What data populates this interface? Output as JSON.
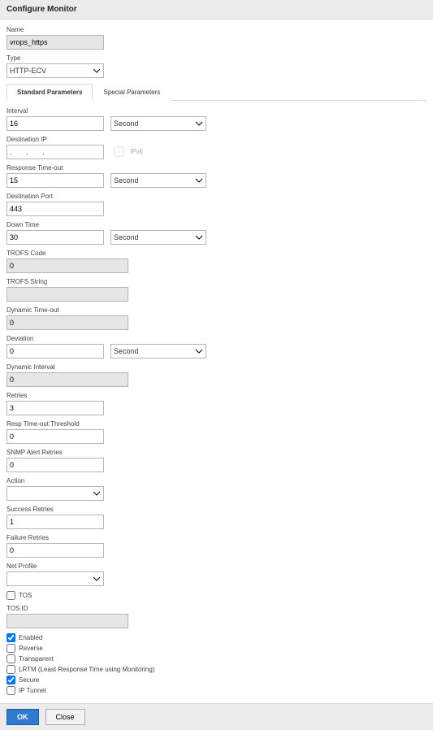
{
  "window": {
    "title": "Configure Monitor"
  },
  "form": {
    "name": {
      "label": "Name",
      "value": "vrops_https"
    },
    "type": {
      "label": "Type",
      "value": "HTTP-ECV"
    }
  },
  "tabs": {
    "standard": "Standard Parameters",
    "special": "Special Parameters"
  },
  "std": {
    "interval": {
      "label": "Interval",
      "value": "16",
      "unit": "Second"
    },
    "destip": {
      "label": "Destination IP",
      "value": ".       .       .",
      "ipv6": "IPv6"
    },
    "resp_to": {
      "label": "Response Time-out",
      "value": "15",
      "unit": "Second"
    },
    "destport": {
      "label": "Destination Port",
      "value": "443"
    },
    "downtime": {
      "label": "Down Time",
      "value": "30",
      "unit": "Second"
    },
    "trofs_code": {
      "label": "TROFS Code",
      "value": "0"
    },
    "trofs_string": {
      "label": "TROFS String",
      "value": ""
    },
    "dyn_to": {
      "label": "Dynamic Time-out",
      "value": "0"
    },
    "deviation": {
      "label": "Deviation",
      "value": "0",
      "unit": "Second"
    },
    "dyn_int": {
      "label": "Dynamic Interval",
      "value": "0"
    },
    "retries": {
      "label": "Retries",
      "value": "3"
    },
    "resp_th": {
      "label": "Resp Time-out Threshold",
      "value": "0"
    },
    "snmp": {
      "label": "SNMP Alert Retries",
      "value": "0"
    },
    "action": {
      "label": "Action",
      "value": ""
    },
    "succ": {
      "label": "Success Retries",
      "value": "1"
    },
    "fail": {
      "label": "Failure Retries",
      "value": "0"
    },
    "netprofile": {
      "label": "Net Profile",
      "value": ""
    },
    "tos": {
      "label": "TOS"
    },
    "tosid": {
      "label": "TOS ID",
      "value": ""
    }
  },
  "checks": {
    "enabled": "Enabled",
    "reverse": "Reverse",
    "transparent": "Transparent",
    "lrtm": "LRTM (Least Response Time using Monitoring)",
    "secure": "Secure",
    "iptunnel": "IP Tunnel"
  },
  "footer": {
    "ok": "OK",
    "close": "Close"
  }
}
